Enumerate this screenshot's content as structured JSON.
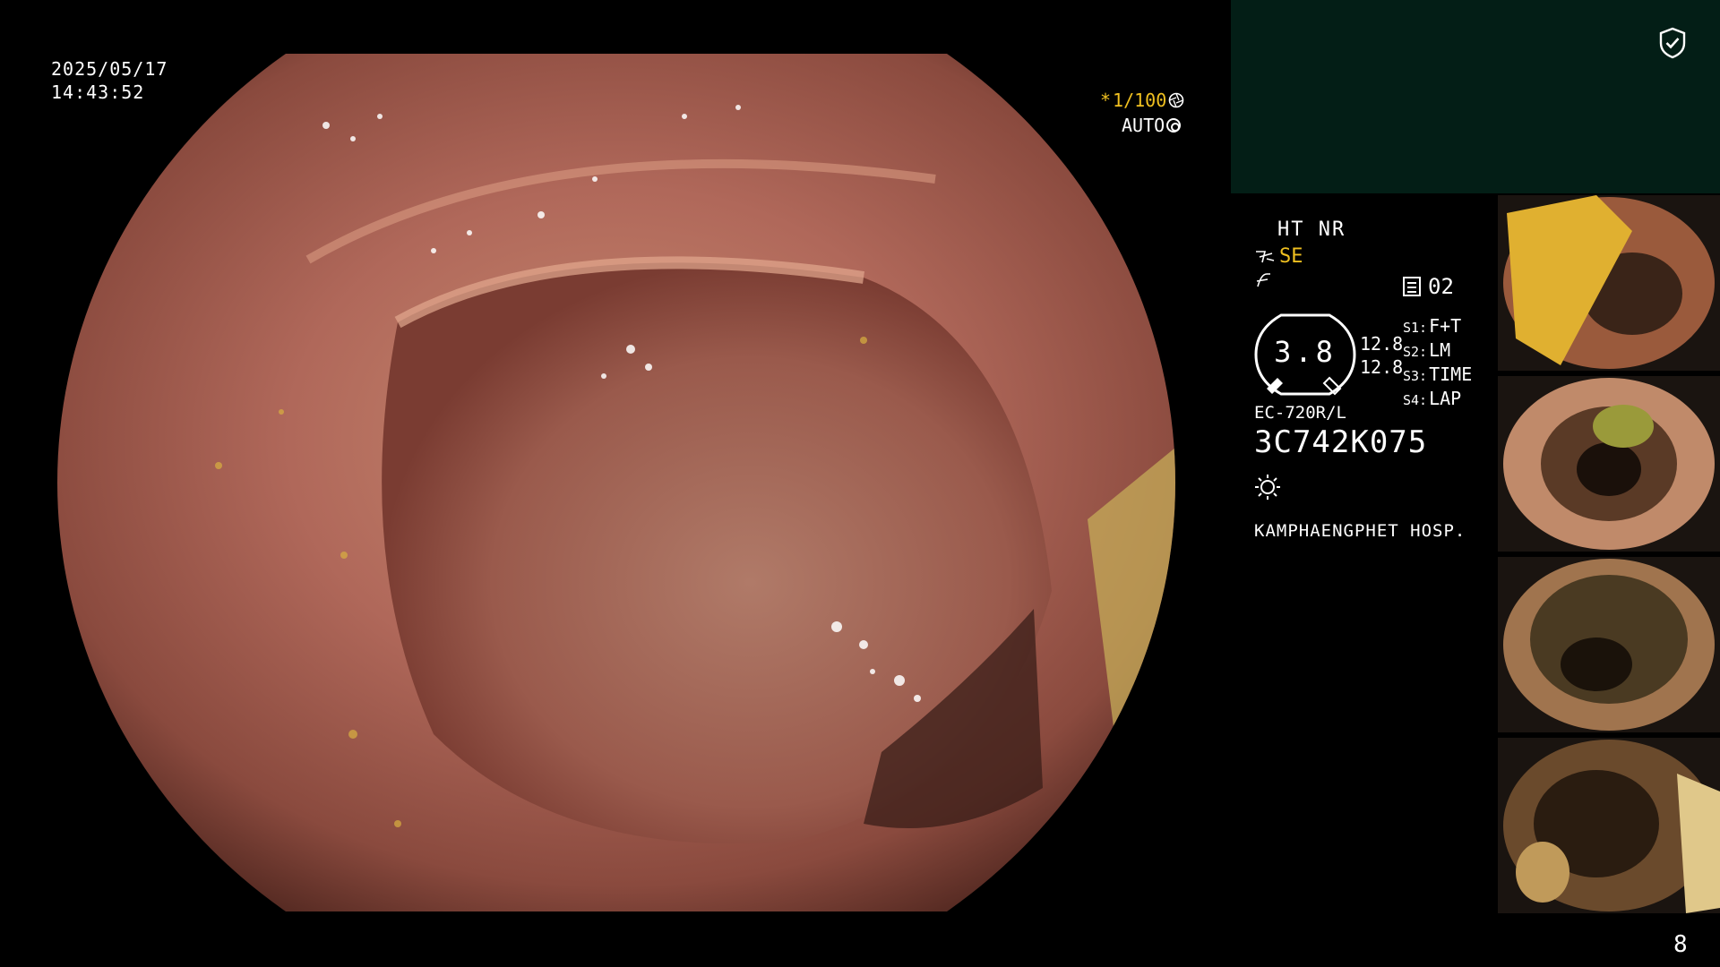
{
  "header": {
    "date": "2025/05/17",
    "time": "14:43:52"
  },
  "overlay": {
    "shutter_value": "1/100",
    "iris_mode": "AUTO"
  },
  "panel": {
    "mode_label": "HT NR",
    "enhance_label": "SE",
    "recording_count": "02",
    "gauge_value": "3.8",
    "gauge_readout_1": "12.8",
    "gauge_readout_2": "12.8",
    "slots": [
      {
        "key": "S1:",
        "value": "F+T"
      },
      {
        "key": "S2:",
        "value": "LM"
      },
      {
        "key": "S3:",
        "value": "TIME"
      },
      {
        "key": "S4:",
        "value": "LAP"
      }
    ],
    "scope_model": "EC-720R/L",
    "serial_number": "3C742K075",
    "hospital": "KAMPHAENGPHET HOSP."
  },
  "footer": {
    "page_number": "8"
  },
  "colors": {
    "accent": "#f0c020",
    "panel_bg": "#031e16",
    "background": "#000000"
  },
  "icons": [
    "shield-check-icon",
    "shutter-icon",
    "iris-icon",
    "scope-icon",
    "structure-icon",
    "disk-icon",
    "light-icon"
  ]
}
